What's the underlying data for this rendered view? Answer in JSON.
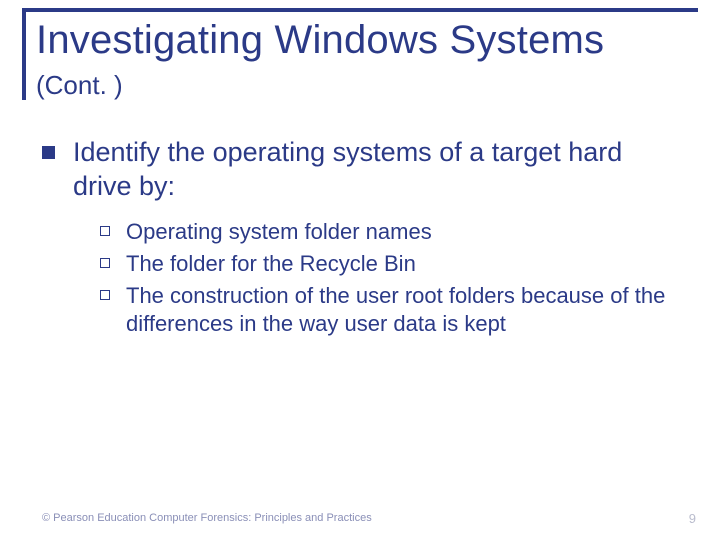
{
  "title": "Investigating Windows Systems",
  "subtitle": "(Cont. )",
  "bullet1": "Identify the operating systems of a target hard drive by:",
  "sub": [
    "Operating system folder names",
    "The folder for the Recycle Bin",
    "The construction of the user root folders because of the differences in the way user data is kept"
  ],
  "footer_left": "© Pearson Education  Computer Forensics: Principles and Practices",
  "page_number": "9"
}
